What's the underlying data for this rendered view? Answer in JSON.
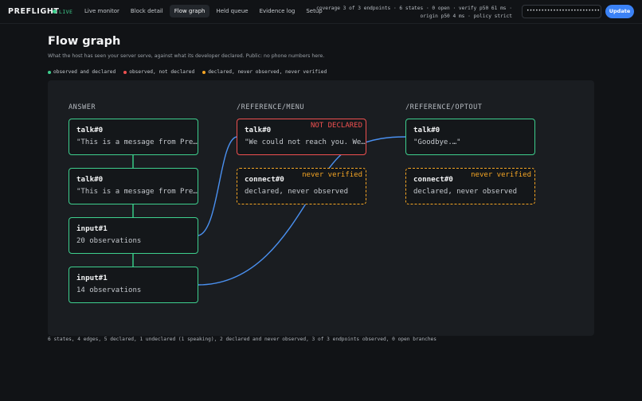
{
  "app": {
    "brand": "PREFLIGHT",
    "live_label": "LIVE"
  },
  "nav": [
    {
      "label": "Live monitor",
      "active": false
    },
    {
      "label": "Block detail",
      "active": false
    },
    {
      "label": "Flow graph",
      "active": true
    },
    {
      "label": "Held queue",
      "active": false
    },
    {
      "label": "Evidence log",
      "active": false
    },
    {
      "label": "Setup",
      "active": false
    }
  ],
  "coverage": {
    "line1": "coverage 3 of 3 endpoints · 6 states · 0 open · verify p50 61 ms ·",
    "line2": "origin p50 4 ms · policy strict"
  },
  "token": {
    "value": "••••••••••••••••••••••••••••"
  },
  "update_label": "Update",
  "page": {
    "title": "Flow graph",
    "subtitle": "What the host has seen your server serve, against what its developer declared. Public: no phone numbers here."
  },
  "legend": [
    {
      "label": "observed and declared",
      "color": "#3ecf8e"
    },
    {
      "label": "observed, not declared",
      "color": "#ef5050"
    },
    {
      "label": "declared, never observed, never verified",
      "color": "#f5a524"
    }
  ],
  "columns": [
    "ANSWER",
    "/REFERENCE/MENU",
    "/REFERENCE/OPTOUT"
  ],
  "nodes": {
    "answer": [
      {
        "name": "talk#0",
        "detail": "\"This is a message from Pre…\"",
        "status": "ok"
      },
      {
        "name": "talk#0",
        "detail": "\"This is a message from Pre…\"",
        "status": "ok"
      },
      {
        "name": "input#1",
        "detail": "20 observations",
        "status": "ok"
      },
      {
        "name": "input#1",
        "detail": "14 observations",
        "status": "ok"
      }
    ],
    "menu": [
      {
        "name": "talk#0",
        "detail": "\"We could not reach you. We…\"",
        "status": "bad",
        "tag": "NOT DECLARED"
      },
      {
        "name": "connect#0",
        "detail": "declared, never observed",
        "status": "warn",
        "tag": "never verified"
      }
    ],
    "optout": [
      {
        "name": "talk#0",
        "detail": "\"Goodbye.…\"",
        "status": "ok"
      },
      {
        "name": "connect#0",
        "detail": "declared, never observed",
        "status": "warn",
        "tag": "never verified"
      }
    ]
  },
  "summary": "6 states, 4 edges, 5 declared, 1 undeclared (1 speaking), 2 declared and never observed, 3 of 3 endpoints observed, 0 open branches",
  "colors": {
    "accent": "#3b82f6",
    "ok": "#3ecf8e",
    "bad": "#ef5050",
    "warn": "#f5a524",
    "edge": "#4a90f0"
  }
}
